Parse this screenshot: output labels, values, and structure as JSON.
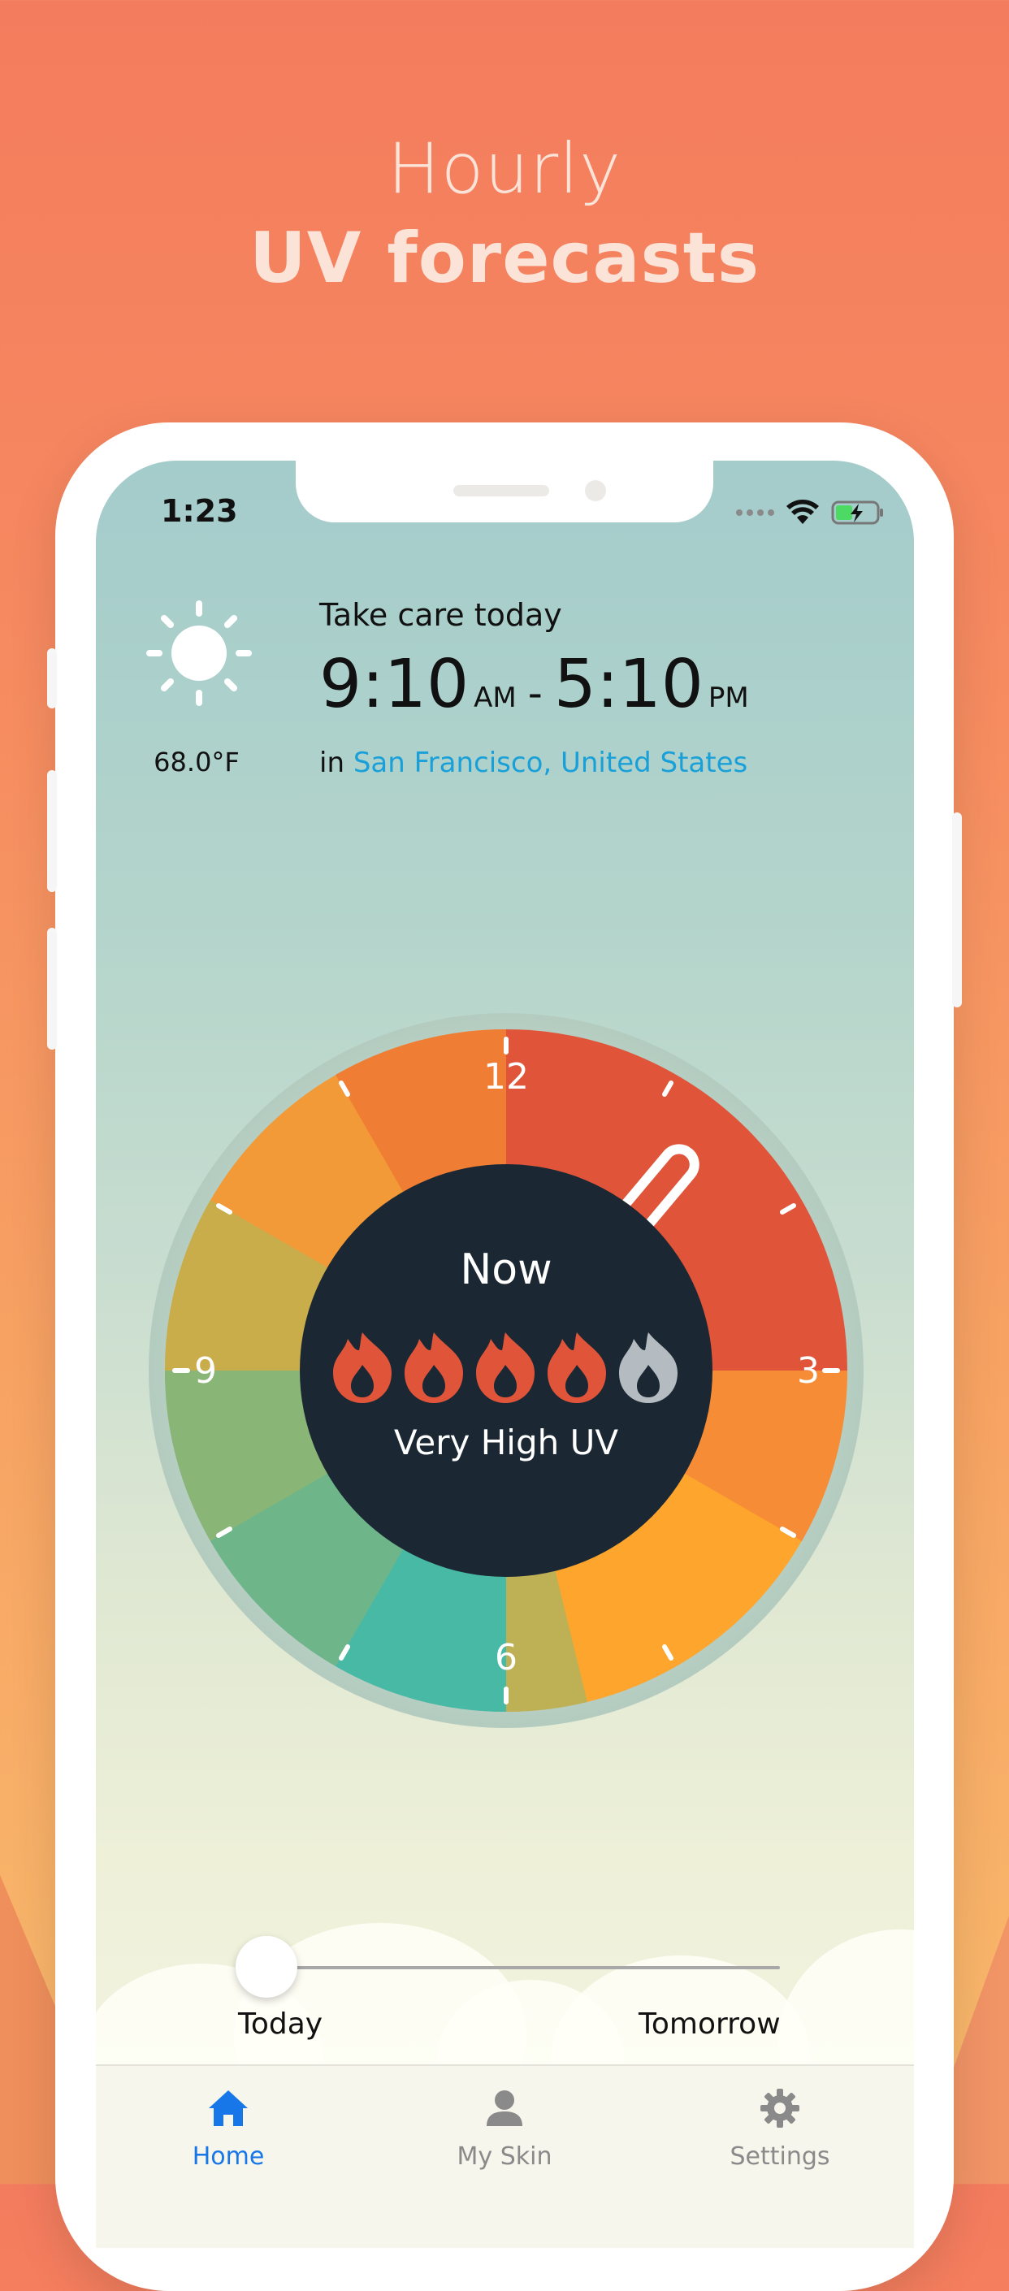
{
  "headline": {
    "line1": "Hourly",
    "line2": "UV forecasts"
  },
  "status_bar": {
    "time": "1:23"
  },
  "weather": {
    "icon": "sun-icon",
    "temperature": "68.0°F",
    "care_text": "Take care today",
    "start_time": "9:10",
    "start_ampm": "AM",
    "separator": "-",
    "end_time": "5:10",
    "end_ampm": "PM",
    "location_prefix": "in",
    "location": "San Francisco, United States"
  },
  "dial": {
    "labels": {
      "twelve": "12",
      "three": "3",
      "six": "6",
      "nine": "9"
    },
    "center_title": "Now",
    "uv_label": "Very High UV",
    "uv_level": 4,
    "uv_max": 5,
    "colors": {
      "very_high": "#e0553a",
      "high": "#fda52c",
      "moderate": "#8bb677",
      "low": "#47b8a5",
      "inactive_flame": "#b5bcc1",
      "center_bg": "#1b2833"
    }
  },
  "slider": {
    "left_label": "Today",
    "right_label": "Tomorrow",
    "position": 0
  },
  "tabbar": {
    "items": [
      {
        "label": "Home",
        "icon": "home-icon",
        "active": true
      },
      {
        "label": "My Skin",
        "icon": "person-icon",
        "active": false
      },
      {
        "label": "Settings",
        "icon": "gear-icon",
        "active": false
      }
    ],
    "active_color": "#1877e8"
  }
}
